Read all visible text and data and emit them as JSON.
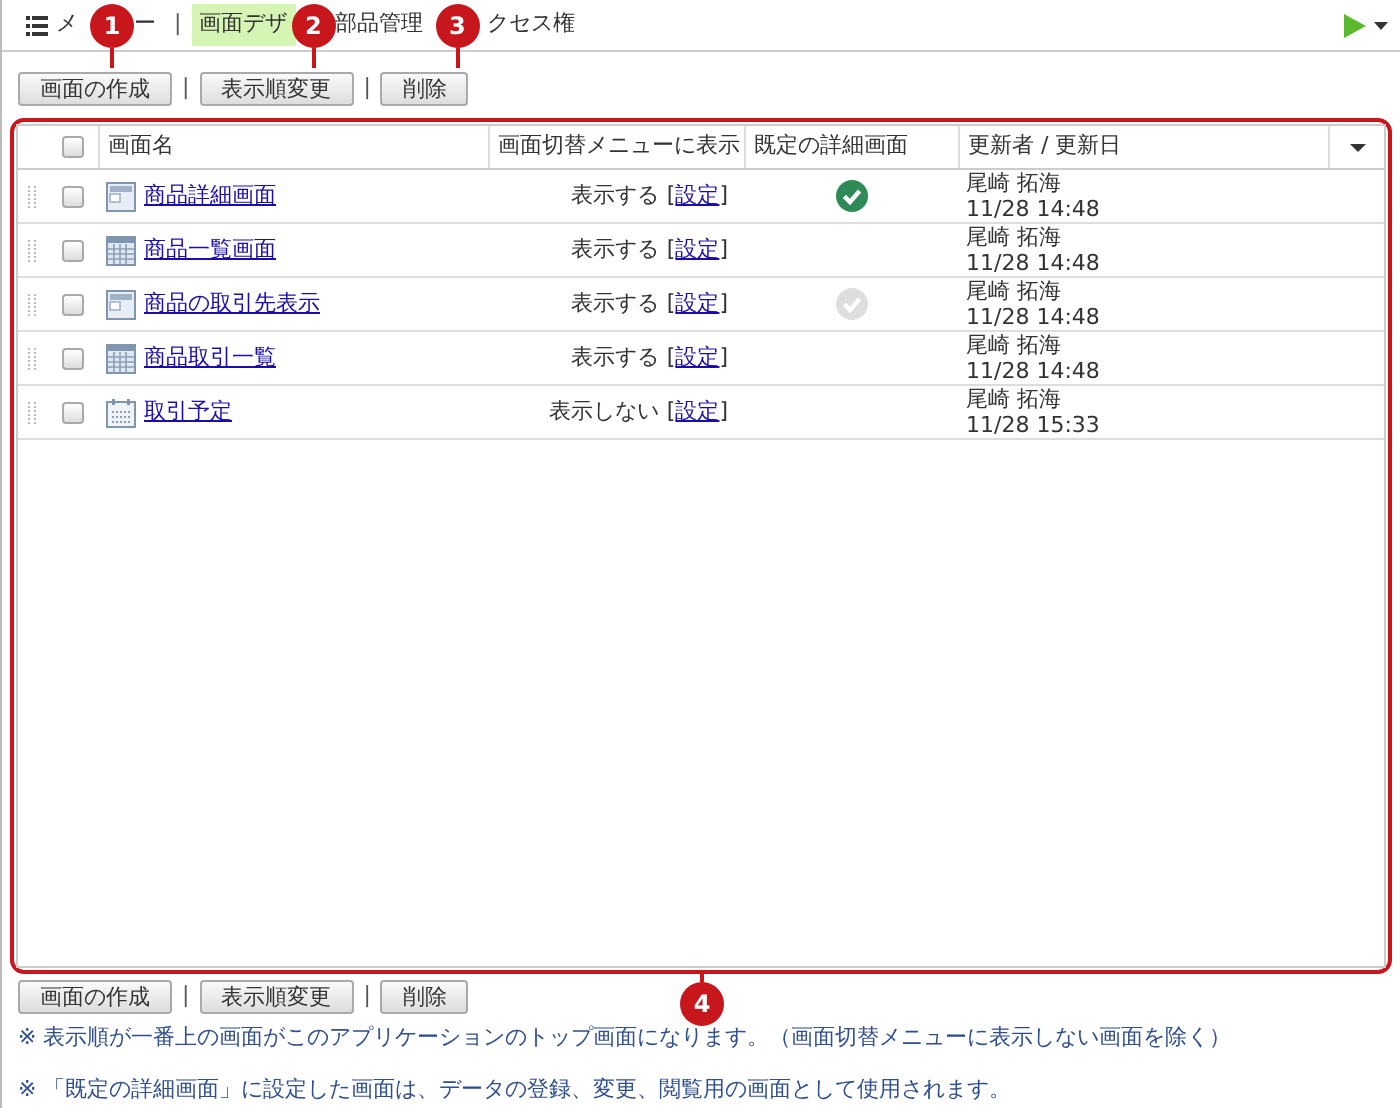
{
  "tabs": [
    {
      "label": "メ",
      "label_end": "ー",
      "kind": "menu",
      "selected": false
    },
    {
      "label": "画面デザ",
      "kind": "tab",
      "selected": true
    },
    {
      "label": "部品管理",
      "kind": "tab",
      "selected": false
    },
    {
      "label": "クセス権",
      "kind": "tab",
      "selected": false
    }
  ],
  "tab_separator": "|",
  "toolbar_top": [
    {
      "kind": "button",
      "label": "画面の作成"
    },
    {
      "kind": "separator",
      "label": "|"
    },
    {
      "kind": "button",
      "label": "表示順変更"
    },
    {
      "kind": "separator",
      "label": "|"
    },
    {
      "kind": "button",
      "label": "削除"
    }
  ],
  "table": {
    "select_all_checked": false,
    "columns": [
      "画面名",
      "画面切替メニューに表示",
      "既定の詳細画面",
      "更新者 / 更新日"
    ],
    "rows": [
      {
        "kind": "form",
        "name": "商品詳細画面",
        "menu_display": "表示する",
        "link_open": "[",
        "setting_link": "設定",
        "link_close": "]",
        "default_candidate": true,
        "default": true,
        "updater": "尾崎 拓海",
        "updated": "11/28 14:48",
        "checked": false
      },
      {
        "kind": "grid",
        "name": "商品一覧画面",
        "menu_display": "表示する",
        "link_open": "[",
        "setting_link": "設定",
        "link_close": "]",
        "default_candidate": false,
        "default": false,
        "updater": "尾崎 拓海",
        "updated": "11/28 14:48",
        "checked": false
      },
      {
        "kind": "form",
        "name": "商品の取引先表示",
        "menu_display": "表示する",
        "link_open": "[",
        "setting_link": "設定",
        "link_close": "]",
        "default_candidate": true,
        "default": false,
        "updater": "尾崎 拓海",
        "updated": "11/28 14:48",
        "checked": false
      },
      {
        "kind": "grid",
        "name": "商品取引一覧",
        "menu_display": "表示する",
        "link_open": "[",
        "setting_link": "設定",
        "link_close": "]",
        "default_candidate": false,
        "default": false,
        "updater": "尾崎 拓海",
        "updated": "11/28 14:48",
        "checked": false
      },
      {
        "kind": "calendar",
        "name": "取引予定",
        "menu_display": "表示しない",
        "link_open": "[",
        "setting_link": "設定",
        "link_close": "]",
        "default_candidate": false,
        "default": false,
        "updater": "尾崎 拓海",
        "updated": "11/28 15:33",
        "checked": false
      }
    ]
  },
  "toolbar_bottom": [
    {
      "kind": "button",
      "label": "画面の作成"
    },
    {
      "kind": "separator",
      "label": "|"
    },
    {
      "kind": "button",
      "label": "表示順変更"
    },
    {
      "kind": "separator",
      "label": "|"
    },
    {
      "kind": "button",
      "label": "削除"
    }
  ],
  "notes": [
    "※ 表示順が一番上の画面がこのアプリケーションのトップ画面になります。（画面切替メニューに表示しない画面を除く）",
    "※ 「既定の詳細画面」に設定した画面は、データの登録、変更、閲覧用の画面として使用されます。"
  ],
  "callouts": [
    "1",
    "2",
    "3",
    "4"
  ]
}
